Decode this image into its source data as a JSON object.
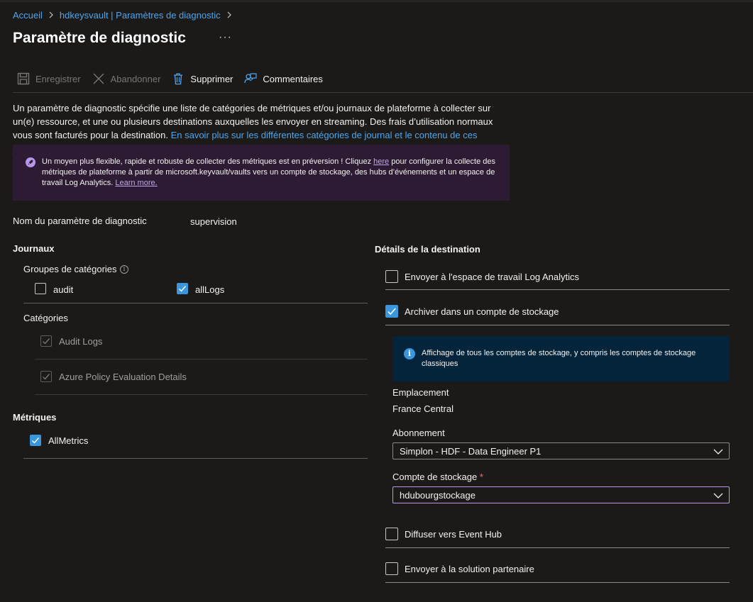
{
  "breadcrumb": {
    "home": "Accueil",
    "parent": "hdkeysvault | Paramètres de diagnostic"
  },
  "page": {
    "title": "Paramètre de diagnostic",
    "more": "···"
  },
  "toolbar": {
    "save": "Enregistrer",
    "discard": "Abandonner",
    "delete": "Supprimer",
    "feedback": "Commentaires"
  },
  "description": {
    "text": "Un paramètre de diagnostic spécifie une liste de catégories de métriques et/ou journaux de plateforme à collecter sur un(e) ressource, et une ou plusieurs destinations auxquelles les envoyer en streaming. Des frais d’utilisation normaux vous sont facturés pour la destination. ",
    "link": "En savoir plus sur les différentes catégories de journal et le contenu de ces journaux"
  },
  "banner": {
    "text1": "Un moyen plus flexible, rapide et robuste de collecter des métriques est en préversion ! Cliquez ",
    "here": "here",
    "text2": " pour configurer la collecte des métriques de plateforme à partir de microsoft.keyvault/vaults vers un compte de stockage, des hubs d’événements et un espace de travail Log Analytics. ",
    "learn": "Learn more."
  },
  "setting_name": {
    "label": "Nom du paramètre de diagnostic",
    "value": "supervision"
  },
  "logs": {
    "title": "Journaux",
    "groups_label": "Groupes de catégories",
    "groups": [
      {
        "label": "audit",
        "checked": false
      },
      {
        "label": "allLogs",
        "checked": true
      }
    ],
    "categories_label": "Catégories",
    "categories": [
      {
        "label": "Audit Logs",
        "checked": true,
        "disabled": true
      },
      {
        "label": "Azure Policy Evaluation Details",
        "checked": true,
        "disabled": true
      }
    ]
  },
  "metrics": {
    "title": "Métriques",
    "items": [
      {
        "label": "AllMetrics",
        "checked": true
      }
    ]
  },
  "destination": {
    "title": "Détails de la destination",
    "log_analytics": {
      "label": "Envoyer à l'espace de travail Log Analytics",
      "checked": false
    },
    "storage": {
      "label": "Archiver dans un compte de stockage",
      "checked": true
    },
    "info": "Affichage de tous les comptes de stockage, y compris les comptes de stockage classiques",
    "location_label": "Emplacement",
    "location_value": "France Central",
    "subscription_label": "Abonnement",
    "subscription_value": "Simplon - HDF - Data Engineer P1",
    "storage_account_label": "Compte de stockage",
    "required_mark": "*",
    "storage_account_value": "hdubourgstockage",
    "event_hub": {
      "label": "Diffuser vers Event Hub",
      "checked": false
    },
    "partner": {
      "label": "Envoyer à la solution partenaire",
      "checked": false
    }
  },
  "colors": {
    "background": "#1b1a19",
    "accent": "#3a96dd",
    "link": "#4ea6ee",
    "banner": "#2d1a33",
    "info_box": "#04243b"
  }
}
